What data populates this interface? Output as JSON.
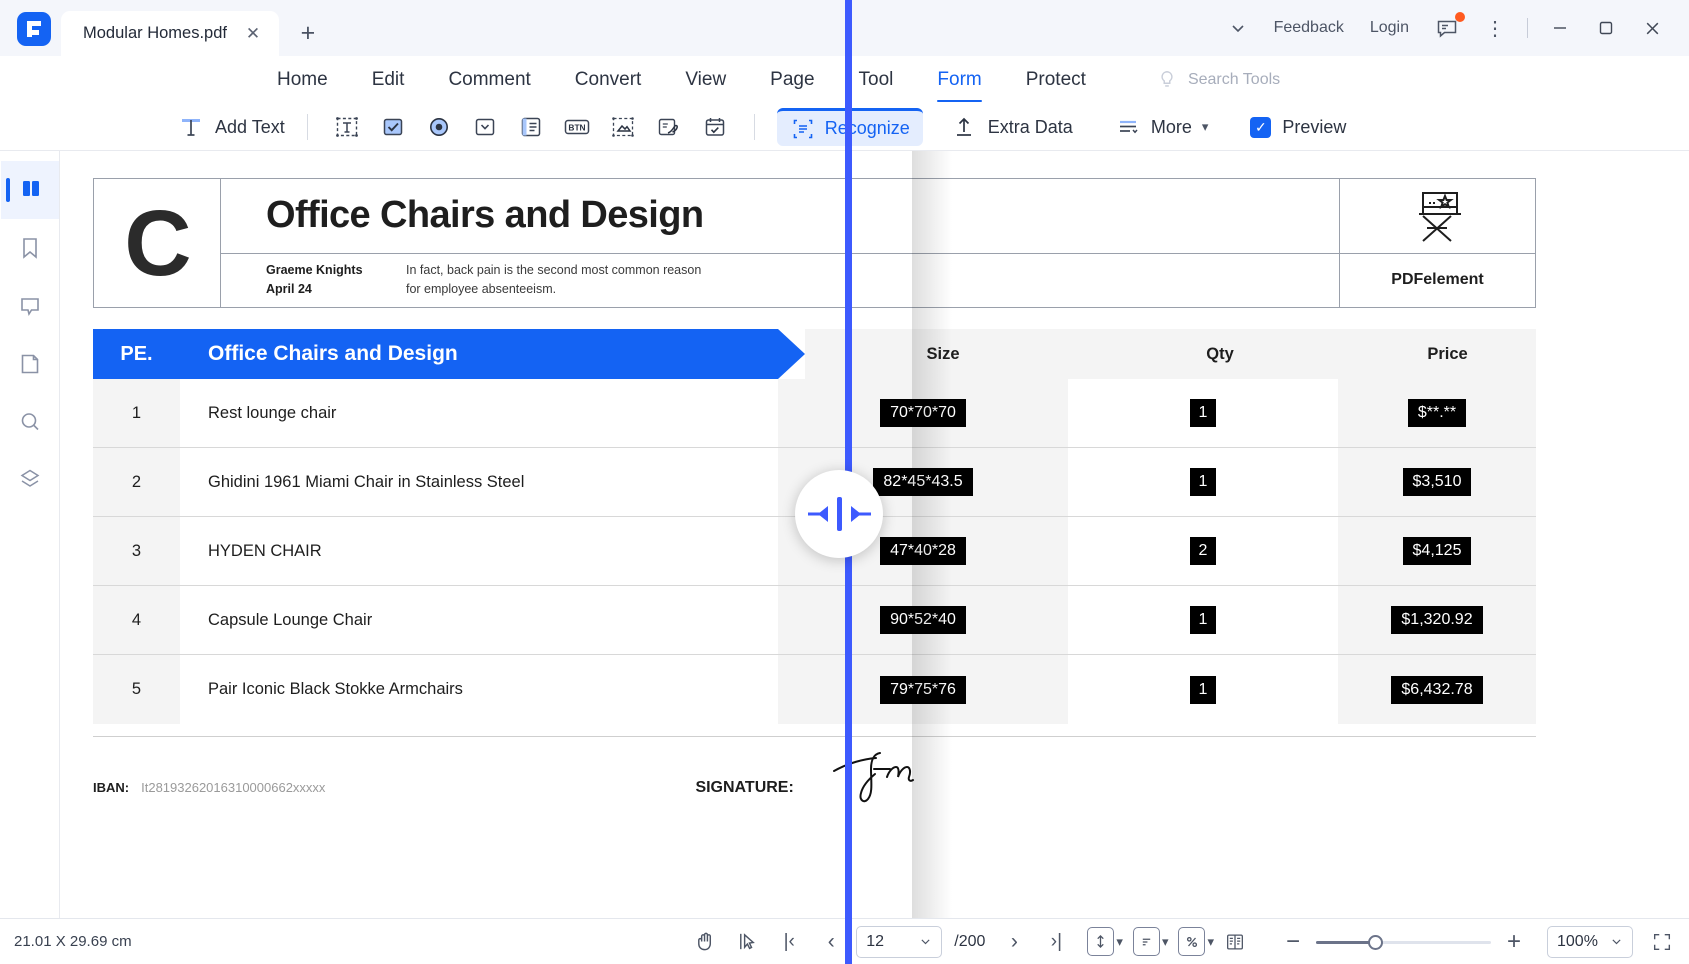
{
  "titlebar": {
    "tab_title": "Modular Homes.pdf",
    "close_label": "✕",
    "new_tab_label": "+",
    "chevron": "⌄",
    "feedback": "Feedback",
    "login": "Login",
    "more_dots": "⋮",
    "minimize": "—",
    "maximize": "☐",
    "close": "✕"
  },
  "menubar": {
    "items": [
      {
        "label": "Home",
        "active": false
      },
      {
        "label": "Edit",
        "active": false
      },
      {
        "label": "Comment",
        "active": false
      },
      {
        "label": "Convert",
        "active": false
      },
      {
        "label": "View",
        "active": false
      },
      {
        "label": "Page",
        "active": false
      },
      {
        "label": "Tool",
        "active": false
      },
      {
        "label": "Form",
        "active": true
      },
      {
        "label": "Protect",
        "active": false
      }
    ],
    "search_placeholder": "Search Tools"
  },
  "ribbon": {
    "add_text": "Add Text",
    "recognize": "Recognize",
    "extra_data": "Extra Data",
    "more": "More",
    "preview": "Preview",
    "preview_checked": true,
    "icons": [
      "text-field-icon",
      "checkbox-field-icon",
      "radio-button-field-icon",
      "combo-box-field-icon",
      "list-box-field-icon",
      "push-button-field-icon",
      "image-field-icon",
      "signature-field-icon",
      "date-field-icon"
    ]
  },
  "leftrail": {
    "items": [
      {
        "name": "thumbnails-panel",
        "active": true
      },
      {
        "name": "bookmarks-panel",
        "active": false
      },
      {
        "name": "comments-panel",
        "active": false
      },
      {
        "name": "attachments-panel",
        "active": false
      },
      {
        "name": "search-panel",
        "active": false
      },
      {
        "name": "layers-panel",
        "active": false
      }
    ]
  },
  "document": {
    "logo_letter": "C",
    "title": "Office Chairs and Design",
    "author": "Graeme Knights",
    "date": "April 24",
    "note_line1": "In fact, back pain is the second most common reason",
    "note_line2": "for employee absenteeism.",
    "brand": "PDFelement",
    "table": {
      "banner_index_label": "PE.",
      "banner_title": "Office Chairs and Design",
      "headers": {
        "size": "Size",
        "qty": "Qty",
        "price": "Price"
      },
      "rows": [
        {
          "idx": "1",
          "name": "Rest lounge chair",
          "size": "70*70*70",
          "qty": "1",
          "price": "$**.**"
        },
        {
          "idx": "2",
          "name": "Ghidini 1961 Miami Chair in Stainless Steel",
          "size": "82*45*43.5",
          "qty": "1",
          "price": "$3,510"
        },
        {
          "idx": "3",
          "name": "HYDEN CHAIR",
          "size": "47*40*28",
          "qty": "2",
          "price": "$4,125"
        },
        {
          "idx": "4",
          "name": "Capsule Lounge Chair",
          "size": "90*52*40",
          "qty": "1",
          "price": "$1,320.92"
        },
        {
          "idx": "5",
          "name": "Pair Iconic Black Stokke Armchairs",
          "size": "79*75*76",
          "qty": "1",
          "price": "$6,432.78"
        }
      ]
    },
    "footer": {
      "iban_label": "IBAN:",
      "iban_value": "It28193262016310000662xxxxx",
      "signature_label": "SIGNATURE:"
    }
  },
  "statusbar": {
    "page_dimensions": "21.01 X 29.69 cm",
    "current_page": "12",
    "total_pages": "/200",
    "zoom_level": "100%",
    "first_page": "|‹",
    "prev_page": "‹",
    "next_page": "›",
    "last_page": "›|",
    "zoom_out": "−",
    "zoom_in": "+"
  },
  "colors": {
    "accent": "#1463f3",
    "split_line": "#3d5afe",
    "banner": "#1463f3",
    "field_bg": "#000000"
  }
}
